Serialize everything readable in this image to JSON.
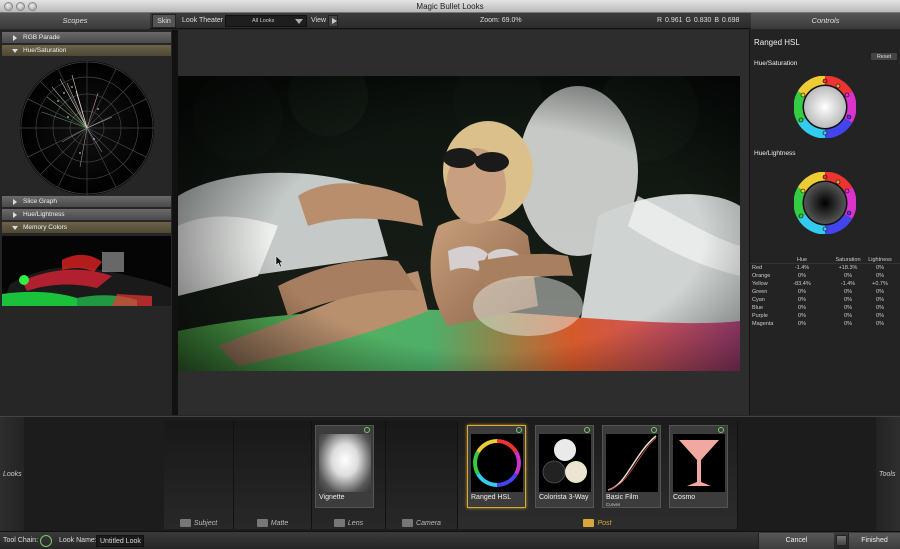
{
  "window": {
    "title": "Magic Bullet Looks"
  },
  "header": {
    "scopes_title": "Scopes",
    "skin_label": "Skin",
    "look_theater_label": "Look Theater",
    "looks_dropdown_value": "All Looks",
    "view_label": "View",
    "zoom_text": "Zoom:  69.0%",
    "rgb_readout": "R 0.961   G 0.830   B 0.698",
    "controls_title": "Controls"
  },
  "scopes": {
    "sections": [
      "RGB Parade",
      "Hue/Saturation",
      "Slice Graph",
      "Hue/Lightness",
      "Memory Colors"
    ]
  },
  "controls": {
    "tool_title": "Ranged HSL",
    "reset_label": "Reset",
    "wheel1_label": "Hue/Saturation",
    "wheel2_label": "Hue/Lightness",
    "table": {
      "headers": [
        "Hue",
        "Saturation",
        "Lightness"
      ],
      "rows": [
        {
          "name": "Red",
          "hue": "-1.4%",
          "sat": "+18.3%",
          "light": "0%"
        },
        {
          "name": "Orange",
          "hue": "0%",
          "sat": "0%",
          "light": "0%"
        },
        {
          "name": "Yellow",
          "hue": "-83.4%",
          "sat": "-1.4%",
          "light": "+0.7%"
        },
        {
          "name": "Green",
          "hue": "0%",
          "sat": "0%",
          "light": "0%"
        },
        {
          "name": "Cyan",
          "hue": "0%",
          "sat": "0%",
          "light": "0%"
        },
        {
          "name": "Blue",
          "hue": "0%",
          "sat": "0%",
          "light": "0%"
        },
        {
          "name": "Purple",
          "hue": "0%",
          "sat": "0%",
          "light": "0%"
        },
        {
          "name": "Magenta",
          "hue": "0%",
          "sat": "0%",
          "light": "0%"
        }
      ]
    }
  },
  "toolchain": {
    "side_left": "Looks",
    "side_right": "Tools",
    "stages": [
      "Subject",
      "Matte",
      "Lens",
      "Camera",
      "Post"
    ],
    "tools": [
      {
        "name": "Vignette",
        "sub": ""
      },
      {
        "name": "Ranged HSL",
        "sub": ""
      },
      {
        "name": "Colorista 3-Way",
        "sub": ""
      },
      {
        "name": "Basic Film",
        "sub": "Curves"
      },
      {
        "name": "Cosmo",
        "sub": ""
      }
    ]
  },
  "statusbar": {
    "tool_chain_label": "Tool Chain:",
    "look_name_label": "Look Name:",
    "look_name_value": "Untitled Look",
    "cancel_label": "Cancel",
    "finished_label": "Finished"
  },
  "colors": {
    "accent": "#d9a83a",
    "power_green": "#77cc66"
  }
}
